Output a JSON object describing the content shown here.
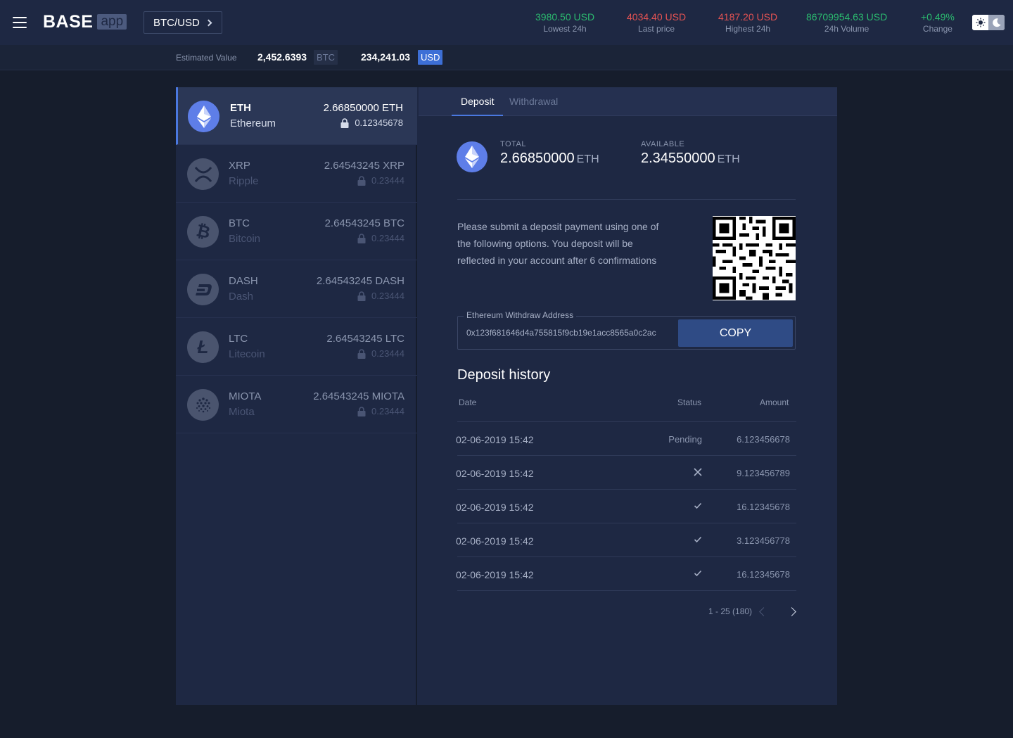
{
  "header": {
    "logo_main": "BASE",
    "logo_badge": "app",
    "pair": "BTC/USD",
    "stats": [
      {
        "value": "3980.50 USD",
        "label": "Lowest 24h"
      },
      {
        "value": "4034.40 USD",
        "label": "Last price"
      },
      {
        "value": "4187.20 USD",
        "label": "Highest 24h"
      },
      {
        "value": "86709954.63 USD",
        "label": "24h Volume"
      },
      {
        "value": "+0.49%",
        "label": "Change"
      }
    ],
    "colors": {
      "positive": "#2bba6f",
      "negative": "#e55353"
    }
  },
  "subheader": {
    "label": "Estimated Value",
    "btc_value": "2,452.6393",
    "btc_unit": "BTC",
    "usd_value": "234,241.03",
    "usd_unit": "USD"
  },
  "coins": [
    {
      "symbol": "ETH",
      "name": "Ethereum",
      "amount": "2.66850000 ETH",
      "locked": "0.12345678",
      "icon": "ethereum-icon"
    },
    {
      "symbol": "XRP",
      "name": "Ripple",
      "amount": "2.64543245 XRP",
      "locked": "0.23444",
      "icon": "ripple-icon"
    },
    {
      "symbol": "BTC",
      "name": "Bitcoin",
      "amount": "2.64543245 BTC",
      "locked": "0.23444",
      "icon": "bitcoin-icon"
    },
    {
      "symbol": "DASH",
      "name": "Dash",
      "amount": "2.64543245 DASH",
      "locked": "0.23444",
      "icon": "dash-icon"
    },
    {
      "symbol": "LTC",
      "name": "Litecoin",
      "amount": "2.64543245 LTC",
      "locked": "0.23444",
      "icon": "litecoin-icon"
    },
    {
      "symbol": "MIOTA",
      "name": "Miota",
      "amount": "2.64543245 MIOTA",
      "locked": "0.23444",
      "icon": "iota-icon"
    }
  ],
  "detail": {
    "tabs": [
      "Deposit",
      "Withdrawal"
    ],
    "total_label": "TOTAL",
    "total_value": "2.66850000",
    "total_unit": "ETH",
    "available_label": "AVAILABLE",
    "available_value": "2.34550000",
    "available_unit": "ETH",
    "note": "Please submit a deposit payment using one of the following options. You deposit will be reflected in your account after 6 confirmations",
    "address_label": "Ethereum Withdraw Address",
    "address_value": "0x123f681646d4a755815f9cb19e1acc8565a0c2ac",
    "copy_label": "COPY",
    "history_title": "Deposit history",
    "columns": [
      "Date",
      "Status",
      "Amount"
    ],
    "rows": [
      {
        "date": "02-06-2019 15:42",
        "status": "Pending",
        "status_icon": "",
        "amount": "6.123456678"
      },
      {
        "date": "02-06-2019 15:42",
        "status": "",
        "status_icon": "close-icon",
        "amount": "9.123456789"
      },
      {
        "date": "02-06-2019 15:42",
        "status": "",
        "status_icon": "check-icon",
        "amount": "16.12345678"
      },
      {
        "date": "02-06-2019 15:42",
        "status": "",
        "status_icon": "check-icon",
        "amount": "3.123456778"
      },
      {
        "date": "02-06-2019 15:42",
        "status": "",
        "status_icon": "check-icon",
        "amount": "16.12345678"
      }
    ],
    "pagination": "1 - 25 (180)"
  }
}
